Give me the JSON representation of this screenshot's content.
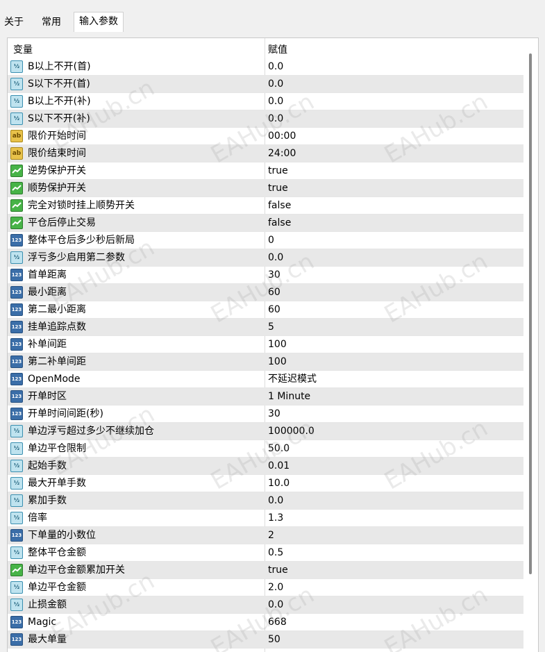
{
  "tabs": [
    {
      "label": "关于"
    },
    {
      "label": "常用"
    },
    {
      "label": "输入参数"
    }
  ],
  "table": {
    "header": {
      "name": "变量",
      "value": "赋值"
    },
    "rows": [
      {
        "type": "double",
        "name": "B以上不开(首)",
        "value": "0.0"
      },
      {
        "type": "double",
        "name": "S以下不开(首)",
        "value": "0.0"
      },
      {
        "type": "double",
        "name": "B以上不开(补)",
        "value": "0.0"
      },
      {
        "type": "double",
        "name": "S以下不开(补)",
        "value": "0.0"
      },
      {
        "type": "string",
        "name": "限价开始时间",
        "value": "00:00"
      },
      {
        "type": "string",
        "name": "限价结束时间",
        "value": "24:00"
      },
      {
        "type": "bool",
        "name": "逆势保护开关",
        "value": "true"
      },
      {
        "type": "bool",
        "name": "顺势保护开关",
        "value": "true"
      },
      {
        "type": "bool",
        "name": "完全对锁时挂上顺势开关",
        "value": "false"
      },
      {
        "type": "bool",
        "name": "平仓后停止交易",
        "value": "false"
      },
      {
        "type": "int",
        "name": "整体平仓后多少秒后新局",
        "value": "0"
      },
      {
        "type": "double",
        "name": "浮亏多少启用第二参数",
        "value": "0.0"
      },
      {
        "type": "int",
        "name": "首单距离",
        "value": "30"
      },
      {
        "type": "int",
        "name": "最小距离",
        "value": "60"
      },
      {
        "type": "int",
        "name": "第二最小距离",
        "value": "60"
      },
      {
        "type": "int",
        "name": "挂单追踪点数",
        "value": "5"
      },
      {
        "type": "int",
        "name": "补单间距",
        "value": "100"
      },
      {
        "type": "int",
        "name": "第二补单间距",
        "value": "100"
      },
      {
        "type": "int",
        "name": "OpenMode",
        "value": "不延迟模式"
      },
      {
        "type": "int",
        "name": "开单时区",
        "value": "1 Minute"
      },
      {
        "type": "int",
        "name": "开单时间间距(秒)",
        "value": "30"
      },
      {
        "type": "double",
        "name": "单边浮亏超过多少不继续加仓",
        "value": "100000.0"
      },
      {
        "type": "double",
        "name": "单边平仓限制",
        "value": "50.0"
      },
      {
        "type": "double",
        "name": "起始手数",
        "value": "0.01"
      },
      {
        "type": "double",
        "name": "最大开单手数",
        "value": "10.0"
      },
      {
        "type": "double",
        "name": "累加手数",
        "value": "0.0"
      },
      {
        "type": "double",
        "name": "倍率",
        "value": "1.3"
      },
      {
        "type": "int",
        "name": "下单量的小数位",
        "value": "2"
      },
      {
        "type": "double",
        "name": "整体平仓金额",
        "value": "0.5"
      },
      {
        "type": "bool",
        "name": "单边平仓金额累加开关",
        "value": "true"
      },
      {
        "type": "double",
        "name": "单边平仓金额",
        "value": "2.0"
      },
      {
        "type": "double",
        "name": "止损金额",
        "value": "0.0"
      },
      {
        "type": "int",
        "name": "Magic",
        "value": "668"
      },
      {
        "type": "int",
        "name": "最大单量",
        "value": "50"
      }
    ]
  },
  "icons": {
    "double": {
      "semantic": "double-type-icon",
      "glyph": "½"
    },
    "int": {
      "semantic": "integer-type-icon",
      "glyph": "123"
    },
    "bool": {
      "semantic": "boolean-type-icon",
      "glyph": ""
    },
    "string": {
      "semantic": "string-type-icon",
      "glyph": "ab"
    }
  },
  "watermark": "EAHub.cn",
  "colors": {
    "alt_row": "#e8e8e8",
    "double_icon": "#bfe3ef",
    "int_icon": "#3b6ea8",
    "bool_icon": "#47b347",
    "string_icon": "#e8c24a"
  }
}
